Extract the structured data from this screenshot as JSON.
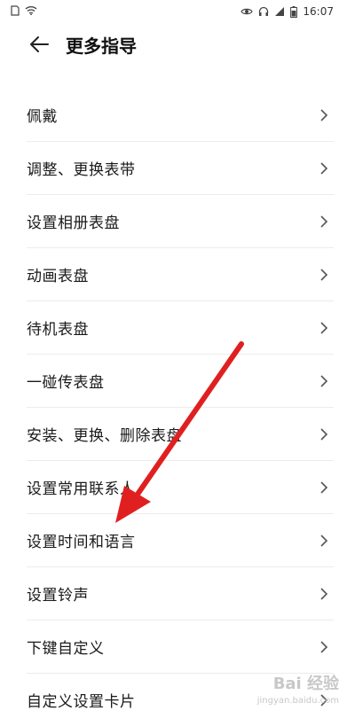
{
  "status_bar": {
    "time": "16:07",
    "icons": [
      "sim-card-icon",
      "wifi-icon",
      "eye-icon",
      "headphones-icon",
      "signal-icon",
      "battery-icon"
    ]
  },
  "header": {
    "title": "更多指导",
    "back_icon": "back-arrow-icon"
  },
  "list": {
    "items": [
      {
        "label": "佩戴"
      },
      {
        "label": "调整、更换表带"
      },
      {
        "label": "设置相册表盘"
      },
      {
        "label": "动画表盘"
      },
      {
        "label": "待机表盘"
      },
      {
        "label": "一碰传表盘"
      },
      {
        "label": "安装、更换、删除表盘"
      },
      {
        "label": "设置常用联系人"
      },
      {
        "label": "设置时间和语言"
      },
      {
        "label": "设置铃声"
      },
      {
        "label": "下键自定义"
      },
      {
        "label": "自定义设置卡片"
      }
    ]
  },
  "annotation": {
    "color": "#e02020",
    "icon": "red-arrow-annotation"
  },
  "watermark": {
    "brand": "Bai 经验",
    "url": "jingyan.baidu.com"
  }
}
